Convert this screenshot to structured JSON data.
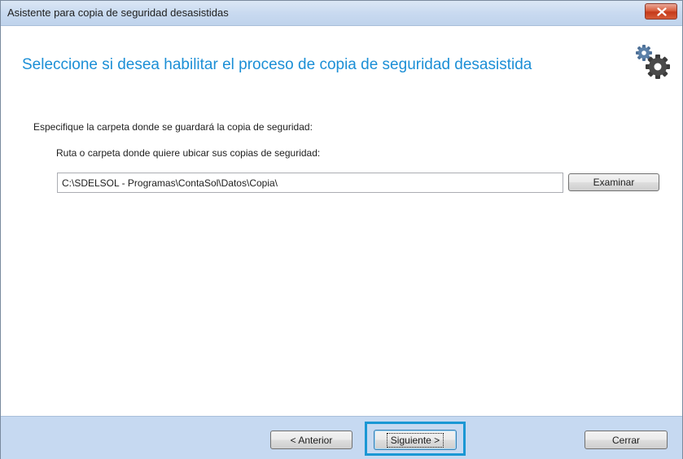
{
  "window": {
    "title": "Asistente para copia de seguridad desasistidas",
    "close_icon": "close-x-icon"
  },
  "header": {
    "heading": "Seleccione si desea habilitar el proceso de copia de seguridad desasistida",
    "heading_color": "#1c8fd6",
    "icon": "gears-icon"
  },
  "main": {
    "folder_label": "Especifique la carpeta donde se guardará la copia de seguridad:",
    "path_label": "Ruta o carpeta donde quiere ubicar sus copias de seguridad:",
    "path_value": "C:\\SDELSOL - Programas\\ContaSol\\Datos\\Copia\\",
    "browse_label": "Examinar"
  },
  "footer": {
    "back_label": "< Anterior",
    "next_label": "Siguiente >",
    "close_label": "Cerrar",
    "focus_color": "#1a97d4",
    "background": "#c6d9f1"
  }
}
